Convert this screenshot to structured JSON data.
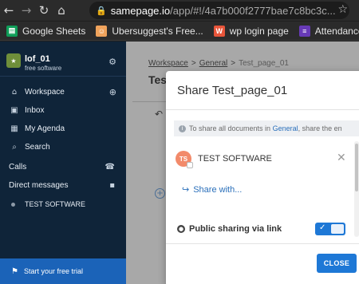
{
  "browser": {
    "url_host": "samepage.io",
    "url_path": "/app/#!/4a7b000f2777bae7c8bc3c..."
  },
  "bookmarks": [
    {
      "label": "Google Sheets",
      "color": "#0f9d58",
      "icon": "sheets-icon"
    },
    {
      "label": "Ubersuggest's Free...",
      "color": "#f0a35c",
      "icon": "ubersuggest-icon"
    },
    {
      "label": "wp login page",
      "color": "#e8553a",
      "icon": "wordpress-icon"
    },
    {
      "label": "Attendance Form in...",
      "color": "#673ab7",
      "icon": "forms-icon"
    }
  ],
  "sidebar": {
    "workspace_name": "lof_01",
    "workspace_sub": "free software",
    "nav": [
      {
        "label": "Workspace",
        "icon": "home-icon"
      },
      {
        "label": "Inbox",
        "icon": "inbox-icon"
      },
      {
        "label": "My Agenda",
        "icon": "calendar-icon"
      },
      {
        "label": "Search",
        "icon": "search-icon"
      }
    ],
    "calls_label": "Calls",
    "dm_label": "Direct messages",
    "dm_items": [
      {
        "label": "TEST SOFTWARE"
      }
    ],
    "trial_label": "Start your free trial"
  },
  "main": {
    "breadcrumb": [
      "Workspace",
      "General",
      "Test_page_01"
    ],
    "title_fragment": "Tes"
  },
  "modal": {
    "title": "Share Test_page_01",
    "info_prefix": "To share all documents in ",
    "info_link": "General",
    "info_suffix": ", share the en",
    "member_initials": "TS",
    "member_name": "TEST SOFTWARE",
    "share_with": "Share with...",
    "public_label": "Public sharing via link",
    "public_enabled": true,
    "close_label": "CLOSE"
  },
  "colors": {
    "sidebar_bg": "#0f2439",
    "accent": "#1e78d6",
    "trial_bg": "#1b63b8"
  }
}
